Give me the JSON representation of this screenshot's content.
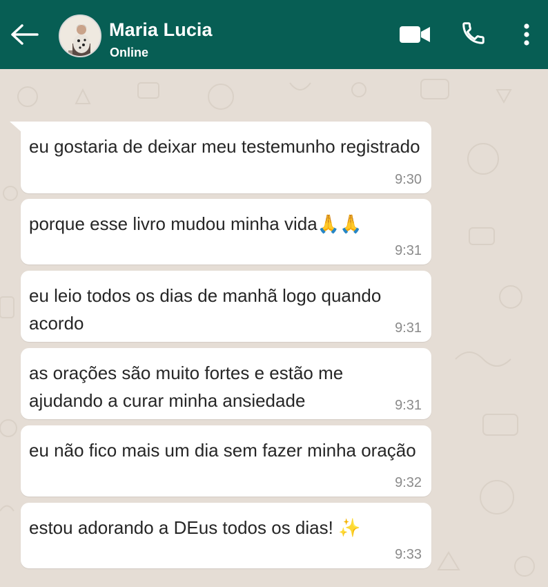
{
  "header": {
    "contact_name": "Maria Lucia",
    "status": "Online",
    "background_color": "#075e54",
    "icons": {
      "back": "arrow-left-icon",
      "video": "video-camera-icon",
      "call": "phone-icon",
      "menu": "more-vertical-icon"
    }
  },
  "chat": {
    "wallpaper_color": "#e5ddd5",
    "bubble_color": "#ffffff",
    "messages": [
      {
        "text": "eu gostaria de deixar meu testemunho registrado",
        "time": "9:30"
      },
      {
        "text": "porque esse livro mudou minha vida🙏🙏",
        "time": "9:31"
      },
      {
        "text": "eu leio todos os dias de manhã logo quando acordo",
        "time": "9:31"
      },
      {
        "text": "as orações são muito fortes e estão me ajudando a curar minha ansiedade",
        "time": "9:31"
      },
      {
        "text": "eu não fico mais um dia sem fazer minha oração",
        "time": "9:32"
      },
      {
        "text": "estou adorando a DEus todos os dias! ✨",
        "time": "9:33"
      }
    ]
  }
}
